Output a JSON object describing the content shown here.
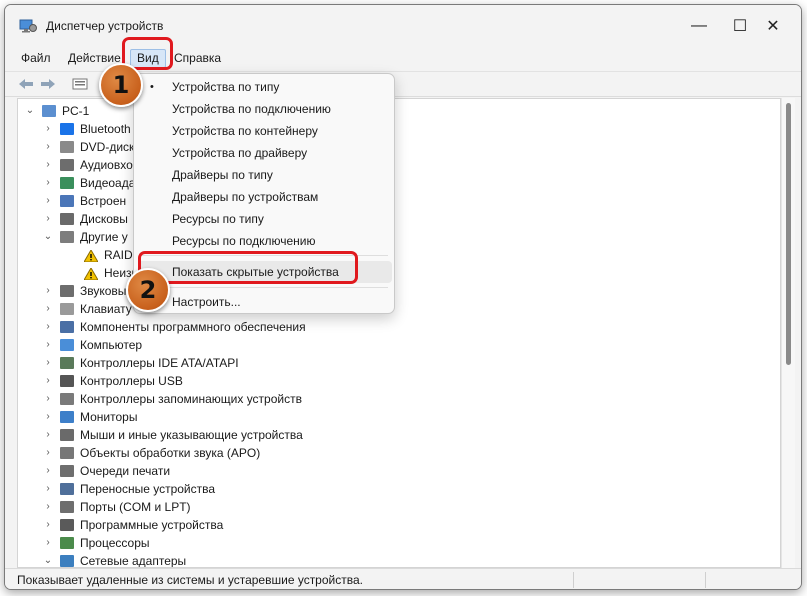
{
  "window": {
    "title": "Диспетчер устройств",
    "minimize_glyph": "—",
    "maximize_glyph": "☐",
    "close_glyph": "✕"
  },
  "menu": {
    "file": "Файл",
    "action": "Действие",
    "view": "Вид",
    "help": "Справка"
  },
  "toolbar": {
    "icons": [
      "back-arrow-icon",
      "forward-arrow-icon",
      "properties-icon",
      "help-icon"
    ]
  },
  "tree": {
    "root": "PC-1",
    "items": [
      {
        "label": "Bluetooth",
        "icon": "bluetooth-icon",
        "expanded": false
      },
      {
        "label": "DVD-диск",
        "icon": "dvd-drive-icon",
        "expanded": false
      },
      {
        "label": "Аудиовхо",
        "icon": "audio-io-icon",
        "expanded": false
      },
      {
        "label": "Видеоада",
        "icon": "display-adapter-icon",
        "expanded": false
      },
      {
        "label": "Встроен",
        "icon": "firmware-icon",
        "expanded": false
      },
      {
        "label": "Дисковы",
        "icon": "disk-drive-icon",
        "expanded": false
      },
      {
        "label": "Другие у",
        "icon": "other-devices-icon",
        "expanded": true
      },
      {
        "label": "RAID-",
        "icon": "warning-device-icon",
        "child": true
      },
      {
        "label": "Неизв",
        "icon": "warning-device-icon",
        "child": true
      },
      {
        "label": "Звуковы",
        "icon": "sound-icon",
        "expanded": false
      },
      {
        "label": "Клавиату",
        "icon": "keyboard-icon",
        "expanded": false
      },
      {
        "label": "Компоненты программного обеспечения",
        "icon": "software-component-icon",
        "expanded": false
      },
      {
        "label": "Компьютер",
        "icon": "computer-icon",
        "expanded": false
      },
      {
        "label": "Контроллеры IDE ATA/ATAPI",
        "icon": "ide-controller-icon",
        "expanded": false
      },
      {
        "label": "Контроллеры USB",
        "icon": "usb-icon",
        "expanded": false
      },
      {
        "label": "Контроллеры запоминающих устройств",
        "icon": "storage-controller-icon",
        "expanded": false
      },
      {
        "label": "Мониторы",
        "icon": "monitor-icon",
        "expanded": false
      },
      {
        "label": "Мыши и иные указывающие устройства",
        "icon": "mouse-icon",
        "expanded": false
      },
      {
        "label": "Объекты обработки звука (APO)",
        "icon": "apo-icon",
        "expanded": false
      },
      {
        "label": "Очереди печати",
        "icon": "printer-icon",
        "expanded": false
      },
      {
        "label": "Переносные устройства",
        "icon": "portable-device-icon",
        "expanded": false
      },
      {
        "label": "Порты (COM и LPT)",
        "icon": "port-icon",
        "expanded": false
      },
      {
        "label": "Программные устройства",
        "icon": "software-device-icon",
        "expanded": false
      },
      {
        "label": "Процессоры",
        "icon": "processor-icon",
        "expanded": false
      },
      {
        "label": "Сетевые адаптеры",
        "icon": "network-adapter-icon",
        "expanded": true
      }
    ]
  },
  "view_menu": {
    "items": [
      {
        "label": "Устройства по типу",
        "checked": true
      },
      {
        "label": "Устройства по подключению"
      },
      {
        "label": "Устройства по контейнеру"
      },
      {
        "label": "Устройства по драйверу"
      },
      {
        "label": "Драйверы по типу"
      },
      {
        "label": "Драйверы по устройствам"
      },
      {
        "label": "Ресурсы по типу"
      },
      {
        "label": "Ресурсы по подключению"
      }
    ],
    "show_hidden": "Показать скрытые устройства",
    "customize": "Настроить...",
    "check_glyph": "•"
  },
  "annotations": {
    "step1": "1",
    "step2": "2",
    "color": "#e0191e"
  },
  "status": {
    "text": "Показывает удаленные из системы и устаревшие устройства."
  }
}
